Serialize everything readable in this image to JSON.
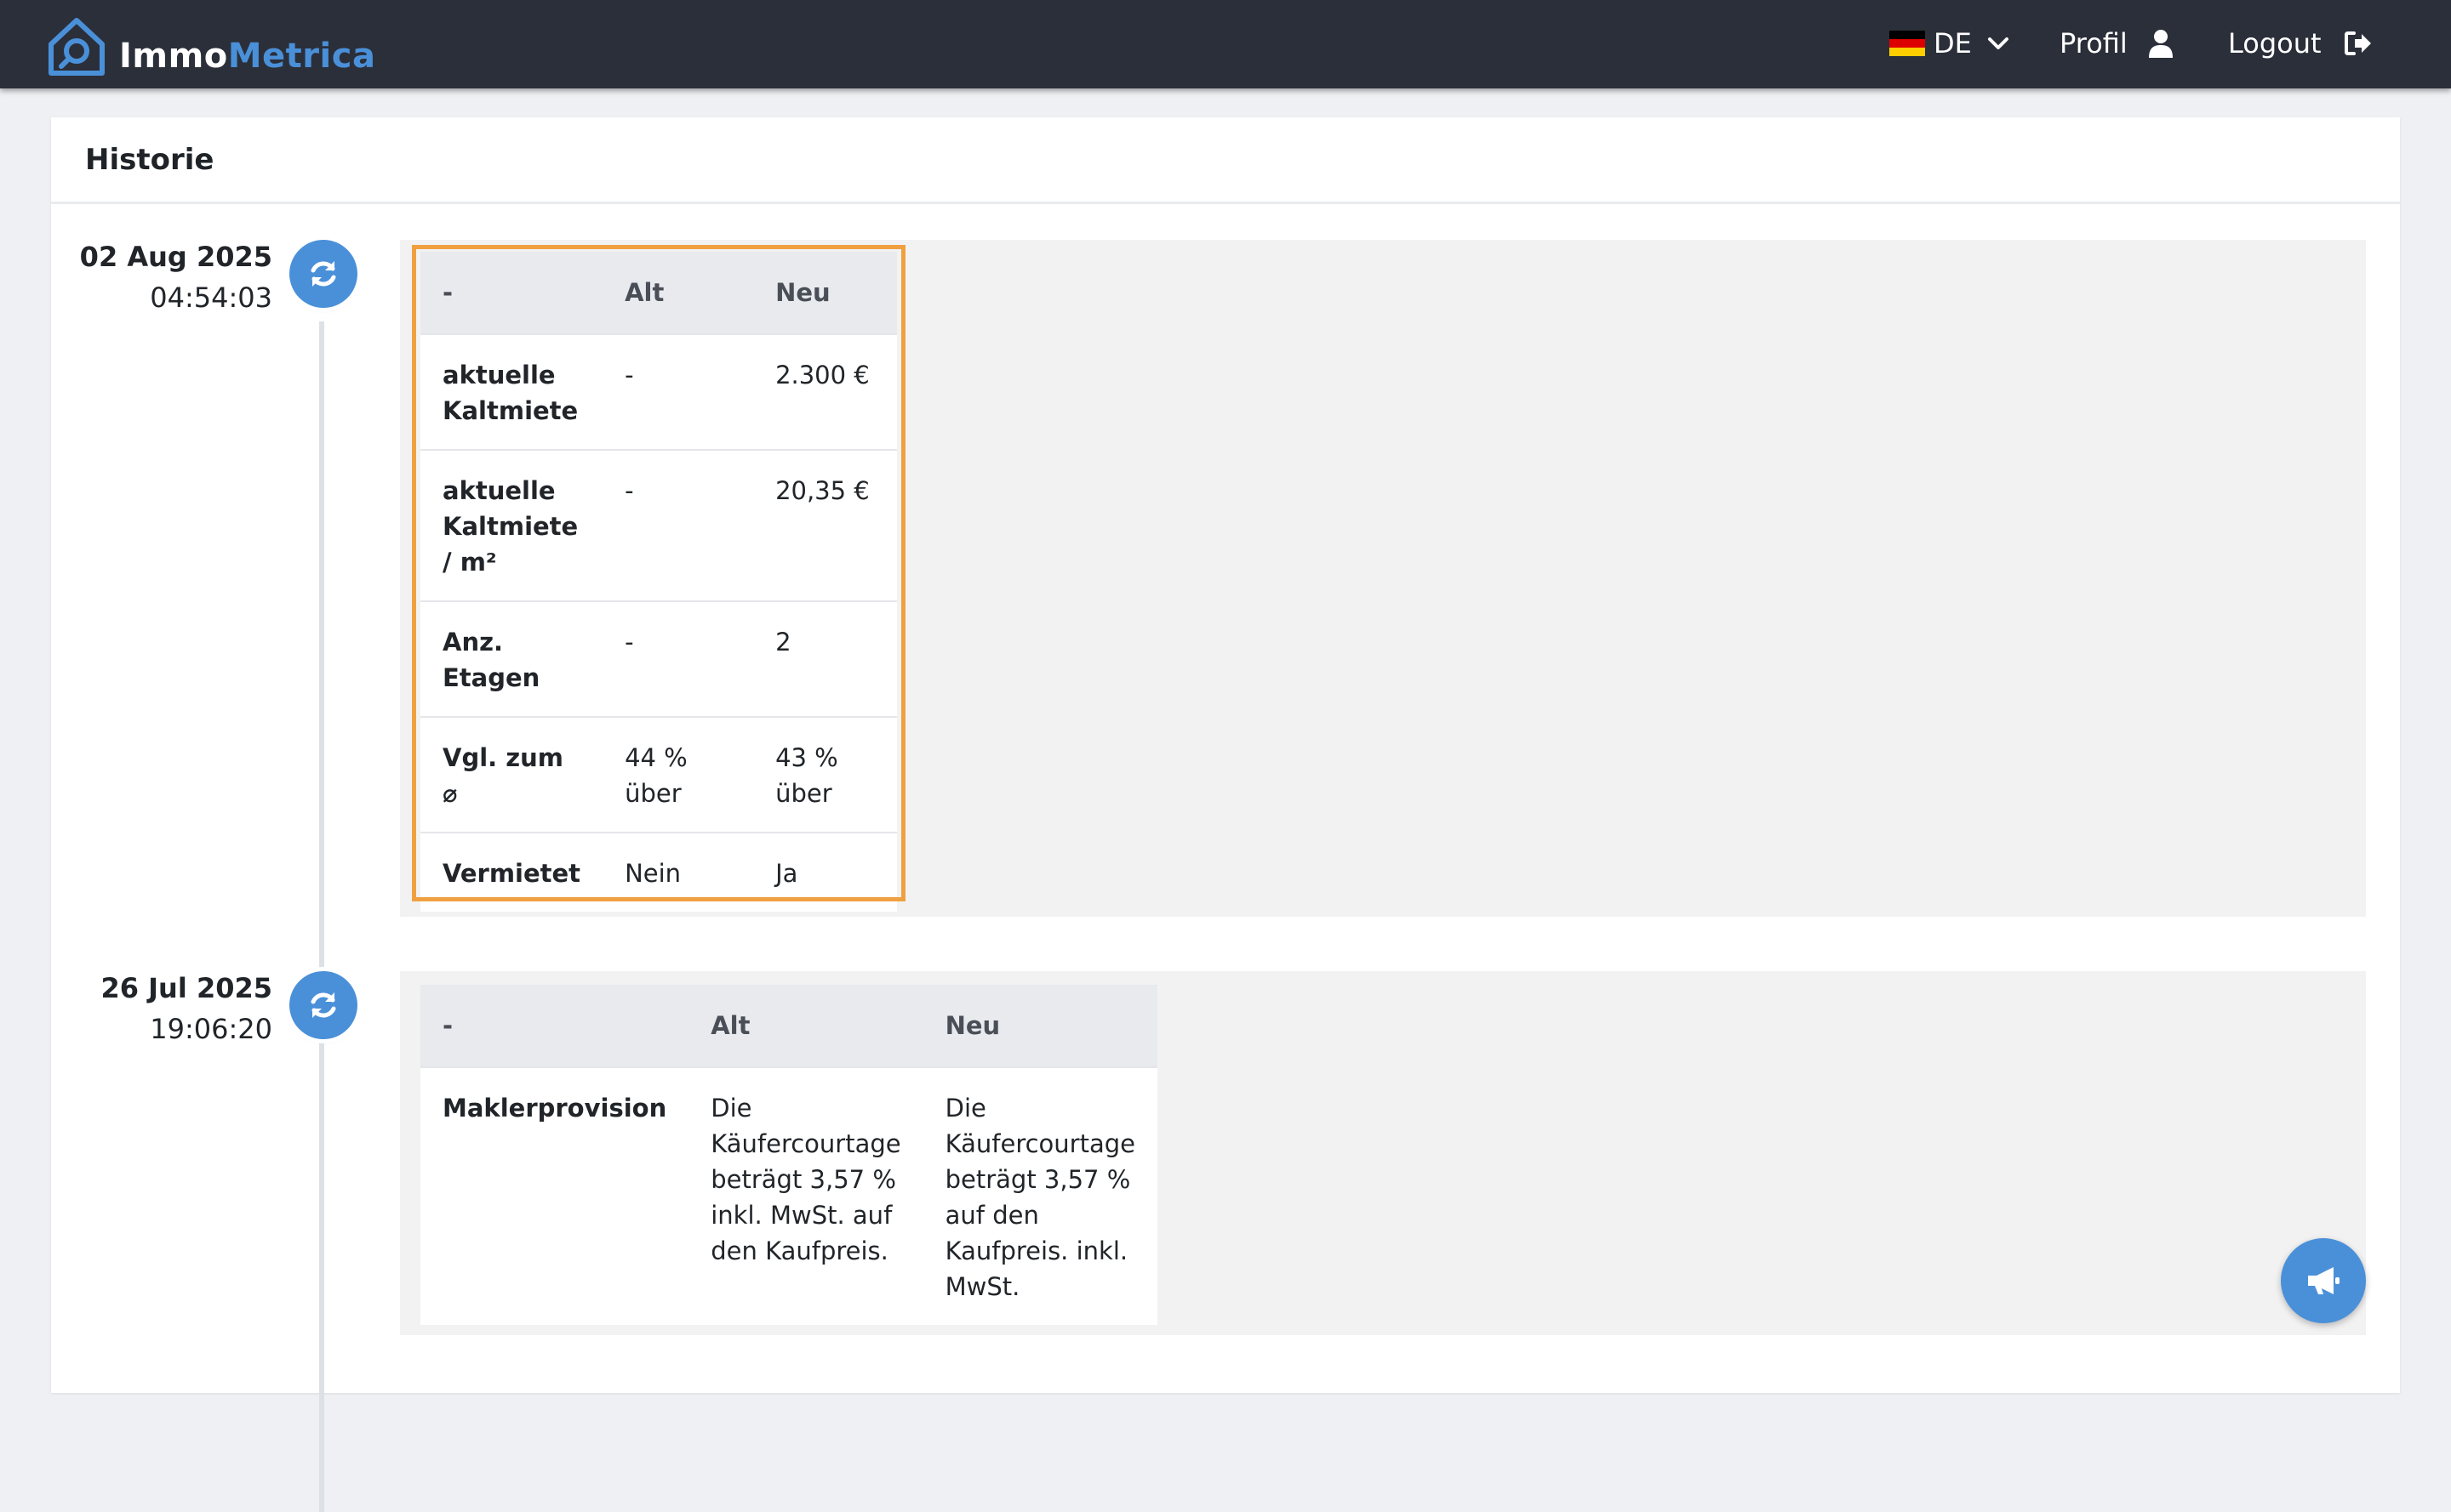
{
  "brand": {
    "part1": "Immo",
    "part2": "Metrica",
    "accent": "#4a90d9"
  },
  "nav": {
    "language": "DE",
    "language_flag": "german-flag-icon",
    "profile": "Profil",
    "logout": "Logout"
  },
  "page": {
    "title": "Historie"
  },
  "entries": [
    {
      "date": "02 Aug 2025",
      "time": "04:54:03",
      "icon": "sync-icon",
      "headers": {
        "field": "-",
        "old": "Alt",
        "new": "Neu"
      },
      "rows": [
        {
          "label": "aktuelle Kaltmiete",
          "old": "-",
          "new": "2.300 €"
        },
        {
          "label": "aktuelle Kaltmiete / m²",
          "old": "-",
          "new": "20,35 €"
        },
        {
          "label": "Anz. Etagen",
          "old": "-",
          "new": "2"
        },
        {
          "label": "Vgl. zum ⌀",
          "old": "44 % über",
          "new": "43 % über"
        },
        {
          "label": "Vermietet",
          "old": "Nein",
          "new": "Ja"
        }
      ]
    },
    {
      "date": "26 Jul 2025",
      "time": "19:06:20",
      "icon": "sync-icon",
      "headers": {
        "field": "-",
        "old": "Alt",
        "new": "Neu"
      },
      "rows": [
        {
          "label": "Maklerprovision",
          "old": "Die Käufercourtage beträgt 3,57 % inkl. MwSt. auf den Kaufpreis.",
          "new": "Die Käufercourtage beträgt 3,57 % auf den Kaufpreis. inkl. MwSt."
        }
      ]
    }
  ],
  "colors": {
    "navbar": "#2b2f3a",
    "highlight": "#f0a040",
    "icon_bg": "#4a90d9"
  }
}
